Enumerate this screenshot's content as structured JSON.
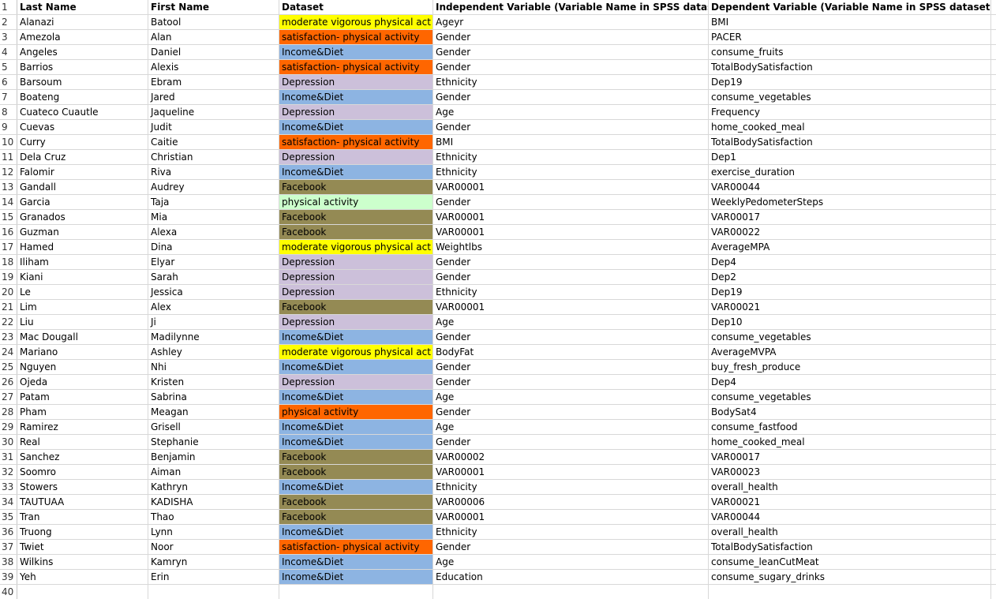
{
  "headers": {
    "last": "Last Name",
    "first": "First Name",
    "dataset": "Dataset",
    "iv": "Independent Variable (Variable Name in SPSS dataset)",
    "dv": "Dependent Variable (Variable Name in SPSS dataset)"
  },
  "dataset_colors": {
    "moderate vigorous physical act": "#ffff00",
    "satisfaction- physical activity": "#ff6600",
    "Income&Diet": "#8db4e2",
    "Depression": "#ccc0da",
    "Facebook": "#948a54",
    "physical activity green": "#ccffcc",
    "physical activity orange": "#ff6600"
  },
  "rows": [
    {
      "n": "2",
      "last": "Alanazi",
      "first": "Batool",
      "dataset": "moderate vigorous physical act",
      "color": "#ffff00",
      "iv": "Ageyr",
      "dv": "BMI"
    },
    {
      "n": "3",
      "last": "Amezola",
      "first": "Alan",
      "dataset": "satisfaction- physical activity",
      "color": "#ff6600",
      "iv": "Gender",
      "dv": "PACER"
    },
    {
      "n": "4",
      "last": "Angeles",
      "first": "Daniel",
      "dataset": "Income&Diet",
      "color": "#8db4e2",
      "iv": "Gender",
      "dv": "consume_fruits"
    },
    {
      "n": "5",
      "last": "Barrios",
      "first": "Alexis",
      "dataset": "satisfaction- physical activity",
      "color": "#ff6600",
      "iv": "Gender",
      "dv": "TotalBodySatisfaction"
    },
    {
      "n": "6",
      "last": "Barsoum",
      "first": "Ebram",
      "dataset": "Depression",
      "color": "#ccc0da",
      "iv": "Ethnicity",
      "dv": "Dep19"
    },
    {
      "n": "7",
      "last": "Boateng",
      "first": "Jared",
      "dataset": "Income&Diet",
      "color": "#8db4e2",
      "iv": "Gender",
      "dv": "consume_vegetables"
    },
    {
      "n": "8",
      "last": "Cuateco Cuautle",
      "first": "Jaqueline",
      "dataset": "Depression",
      "color": "#ccc0da",
      "iv": "Age",
      "dv": "Frequency"
    },
    {
      "n": "9",
      "last": "Cuevas",
      "first": "Judit",
      "dataset": "Income&Diet",
      "color": "#8db4e2",
      "iv": "Gender",
      "dv": "home_cooked_meal"
    },
    {
      "n": "10",
      "last": "Curry",
      "first": "Caitie",
      "dataset": "satisfaction- physical activity",
      "color": "#ff6600",
      "iv": "BMI",
      "dv": "TotalBodySatisfaction"
    },
    {
      "n": "11",
      "last": "Dela Cruz",
      "first": "Christian",
      "dataset": "Depression",
      "color": "#ccc0da",
      "iv": "Ethnicity",
      "dv": "Dep1"
    },
    {
      "n": "12",
      "last": "Falomir",
      "first": "Riva",
      "dataset": "Income&Diet",
      "color": "#8db4e2",
      "iv": "Ethnicity",
      "dv": "exercise_duration"
    },
    {
      "n": "13",
      "last": "Gandall",
      "first": "Audrey",
      "dataset": "Facebook",
      "color": "#948a54",
      "iv": "VAR00001",
      "dv": "VAR00044"
    },
    {
      "n": "14",
      "last": "Garcia",
      "first": "Taja",
      "dataset": "physical activity",
      "color": "#ccffcc",
      "iv": "Gender",
      "dv": "WeeklyPedometerSteps"
    },
    {
      "n": "15",
      "last": "Granados",
      "first": "Mia",
      "dataset": "Facebook",
      "color": "#948a54",
      "iv": "VAR00001",
      "dv": "VAR00017"
    },
    {
      "n": "16",
      "last": "Guzman",
      "first": "Alexa",
      "dataset": "Facebook",
      "color": "#948a54",
      "iv": "VAR00001",
      "dv": "VAR00022"
    },
    {
      "n": "17",
      "last": "Hamed",
      "first": "Dina",
      "dataset": "moderate vigorous physical act",
      "color": "#ffff00",
      "iv": "Weightlbs",
      "dv": "AverageMPA"
    },
    {
      "n": "18",
      "last": "Iliham",
      "first": "Elyar",
      "dataset": "Depression",
      "color": "#ccc0da",
      "iv": "Gender",
      "dv": "Dep4"
    },
    {
      "n": "19",
      "last": "Kiani",
      "first": "Sarah",
      "dataset": "Depression",
      "color": "#ccc0da",
      "iv": "Gender",
      "dv": "Dep2"
    },
    {
      "n": "20",
      "last": "Le",
      "first": "Jessica",
      "dataset": "Depression",
      "color": "#ccc0da",
      "iv": "Ethnicity",
      "dv": "Dep19"
    },
    {
      "n": "21",
      "last": "Lim",
      "first": "Alex",
      "dataset": "Facebook",
      "color": "#948a54",
      "iv": "VAR00001",
      "dv": "VAR00021"
    },
    {
      "n": "22",
      "last": "Liu",
      "first": "Ji",
      "dataset": "Depression",
      "color": "#ccc0da",
      "iv": "Age",
      "dv": "Dep10"
    },
    {
      "n": "23",
      "last": "Mac Dougall",
      "first": "Madilynne",
      "dataset": "Income&Diet",
      "color": "#8db4e2",
      "iv": "Gender",
      "dv": "consume_vegetables"
    },
    {
      "n": "24",
      "last": "Mariano",
      "first": "Ashley",
      "dataset": "moderate vigorous physical act",
      "color": "#ffff00",
      "iv": "BodyFat",
      "dv": "AverageMVPA"
    },
    {
      "n": "25",
      "last": "Nguyen",
      "first": "Nhi",
      "dataset": "Income&Diet",
      "color": "#8db4e2",
      "iv": "Gender",
      "dv": "buy_fresh_produce"
    },
    {
      "n": "26",
      "last": "Ojeda",
      "first": "Kristen",
      "dataset": "Depression",
      "color": "#ccc0da",
      "iv": "Gender",
      "dv": "Dep4"
    },
    {
      "n": "27",
      "last": "Patam",
      "first": "Sabrina",
      "dataset": "Income&Diet",
      "color": "#8db4e2",
      "iv": "Age",
      "dv": "consume_vegetables"
    },
    {
      "n": "28",
      "last": "Pham",
      "first": "Meagan",
      "dataset": "physical activity",
      "color": "#ff6600",
      "iv": "Gender",
      "dv": "BodySat4"
    },
    {
      "n": "29",
      "last": "Ramirez",
      "first": "Grisell",
      "dataset": "Income&Diet",
      "color": "#8db4e2",
      "iv": "Age",
      "dv": "consume_fastfood"
    },
    {
      "n": "30",
      "last": "Real",
      "first": "Stephanie",
      "dataset": "Income&Diet",
      "color": "#8db4e2",
      "iv": "Gender",
      "dv": "home_cooked_meal"
    },
    {
      "n": "31",
      "last": "Sanchez",
      "first": "Benjamin",
      "dataset": "Facebook",
      "color": "#948a54",
      "iv": "VAR00002",
      "dv": "VAR00017"
    },
    {
      "n": "32",
      "last": "Soomro",
      "first": "Aiman",
      "dataset": "Facebook",
      "color": "#948a54",
      "iv": "VAR00001",
      "dv": "VAR00023"
    },
    {
      "n": "33",
      "last": "Stowers",
      "first": "Kathryn",
      "dataset": "Income&Diet",
      "color": "#8db4e2",
      "iv": "Ethnicity",
      "dv": "overall_health"
    },
    {
      "n": "34",
      "last": "TAUTUAA",
      "first": "KADISHA",
      "dataset": "Facebook",
      "color": "#948a54",
      "iv": "VAR00006",
      "dv": "VAR00021"
    },
    {
      "n": "35",
      "last": "Tran",
      "first": "Thao",
      "dataset": "Facebook",
      "color": "#948a54",
      "iv": "VAR00001",
      "dv": "VAR00044"
    },
    {
      "n": "36",
      "last": "Truong",
      "first": "Lynn",
      "dataset": "Income&Diet",
      "color": "#8db4e2",
      "iv": "Ethnicity",
      "dv": "overall_health"
    },
    {
      "n": "37",
      "last": "Twiet",
      "first": "Noor",
      "dataset": "satisfaction- physical activity",
      "color": "#ff6600",
      "iv": "Gender",
      "dv": "TotalBodySatisfaction"
    },
    {
      "n": "38",
      "last": "Wilkins",
      "first": "Kamryn",
      "dataset": "Income&Diet",
      "color": "#8db4e2",
      "iv": "Age",
      "dv": "consume_leanCutMeat"
    },
    {
      "n": "39",
      "last": "Yeh",
      "first": "Erin",
      "dataset": "Income&Diet",
      "color": "#8db4e2",
      "iv": "Education",
      "dv": "consume_sugary_drinks"
    }
  ],
  "empty_rows": [
    "40"
  ],
  "header_row_number": "1"
}
